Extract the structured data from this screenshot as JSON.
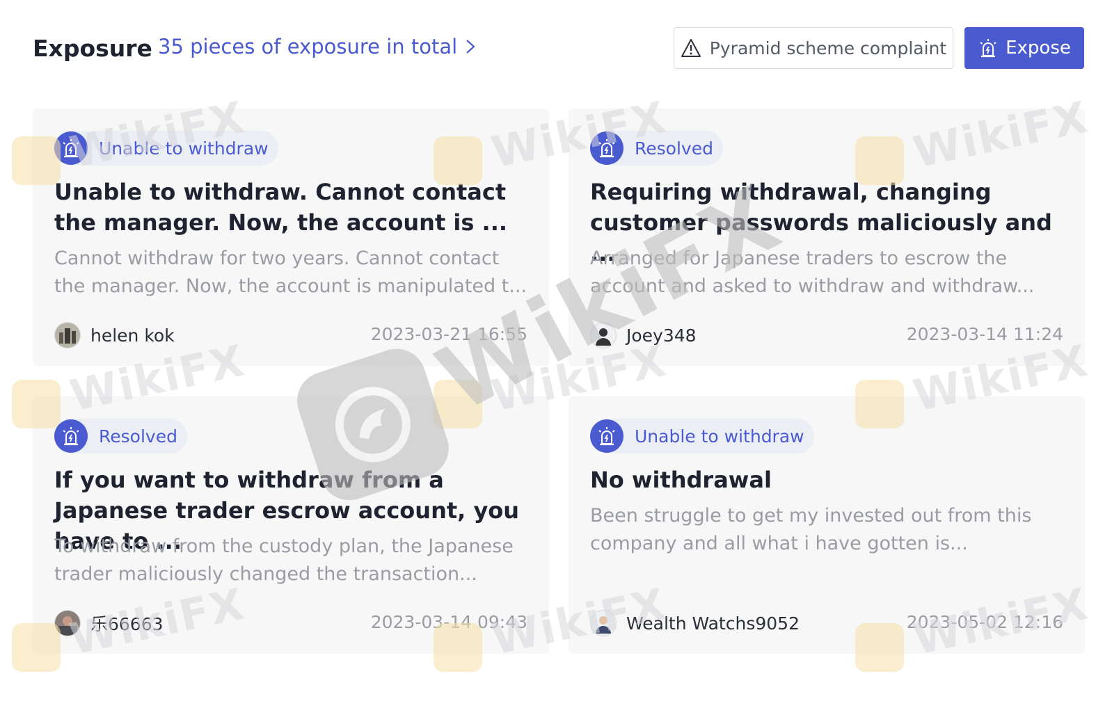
{
  "header": {
    "title": "Exposure",
    "total_link": "35 pieces of exposure in total",
    "complaint_button": "Pyramid scheme complaint",
    "expose_button": "Expose"
  },
  "cards": [
    {
      "tag": "Unable to withdraw",
      "title": "Unable to withdraw. Cannot contact the manager. Now, the account is ...",
      "description": "Cannot withdraw for two years. Cannot contact the manager. Now, the account is manipulated t...",
      "author": "helen kok",
      "date": "2023-03-21 16:55"
    },
    {
      "tag": "Resolved",
      "title": "Requiring withdrawal, changing customer passwords maliciously and ...",
      "description": "Arranged for Japanese traders to escrow the account and asked to withdraw and withdraw...",
      "author": "Joey348",
      "date": "2023-03-14 11:24"
    },
    {
      "tag": "Resolved",
      "title": "If you want to withdraw from a Japanese trader escrow account, you have to ...",
      "description": "To withdraw from the custody plan, the Japanese trader maliciously changed the transaction...",
      "author": "乐66663",
      "date": "2023-03-14 09:43"
    },
    {
      "tag": "Unable to withdraw",
      "title": "No withdrawal",
      "description": "Been struggle to get my invested out from this company and all what i have gotten is...",
      "author": "Wealth Watchs9052",
      "date": "2023-05-02 12:16"
    }
  ],
  "watermark": "WikiFX",
  "colors": {
    "accent": "#4a5bd0",
    "tag_bg": "#eceef6",
    "card_bg": "#f7f7f8",
    "muted_text": "#9a9ca3"
  }
}
